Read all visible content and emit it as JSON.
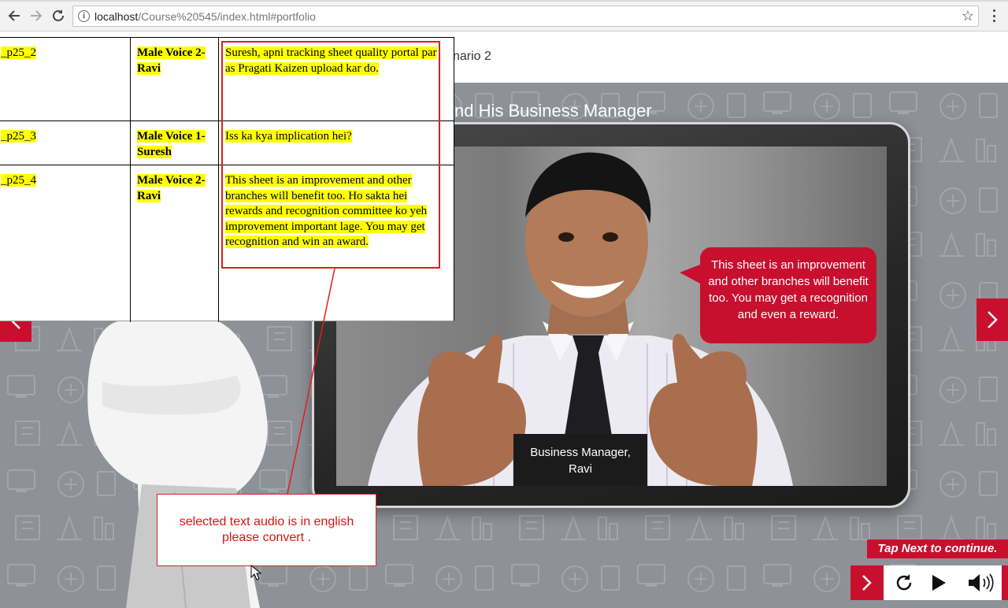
{
  "browser": {
    "url_host": "localhost",
    "url_path": "/Course%20545/index.html#portfolio",
    "back_icon": "arrow-left-icon",
    "forward_icon": "arrow-right-icon",
    "reload_icon": "reload-icon",
    "info_glyph": "i",
    "star_glyph": "☆"
  },
  "course": {
    "scenario_label": "nario 2",
    "stage_title": "nd His Business Manager",
    "speech_bubble": "This sheet is an improvement and other branches will benefit too. You may get a recognition and even a reward.",
    "caption": "Business Manager, Ravi",
    "tap_next": "Tap Next to continue."
  },
  "script_table": {
    "rows": [
      {
        "id": "_p25_2",
        "voice": "Male Voice 2-Ravi",
        "text": "Suresh, apni tracking sheet quality portal par as Pragati Kaizen upload kar do."
      },
      {
        "id": "_p25_3",
        "voice": "Male Voice 1-Suresh",
        "text": "Iss ka kya implication  hei?"
      },
      {
        "id": "_p25_4",
        "voice": "Male Voice 2-Ravi",
        "text": "This sheet is an improvement  and other branches will benefit too. Ho sakta hei rewards and recognition committee ko yeh improvement important lage. You may get recognition and win an award."
      }
    ]
  },
  "annotation": {
    "callout_text": "selected text audio is in english please convert ."
  },
  "colors": {
    "brand_red": "#c8102e",
    "stage_gray": "#8e9198",
    "highlight": "#ffff00",
    "annotation_red": "#e01e1e"
  }
}
